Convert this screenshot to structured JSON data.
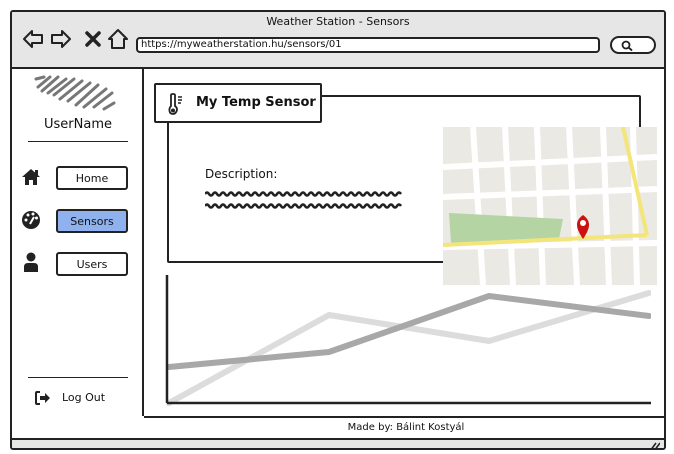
{
  "window": {
    "title": "Weather Station - Sensors"
  },
  "toolbar": {
    "back_icon": "left-arrow-outline-icon",
    "forward_icon": "right-arrow-outline-icon",
    "close_icon": "x-icon",
    "home_icon": "home-outline-icon",
    "url": "https://myweatherstation.hu/sensors/01",
    "search_icon": "search-icon"
  },
  "sidebar": {
    "username": "UserName",
    "items": [
      {
        "label": "Home",
        "icon": "home-icon",
        "active": false
      },
      {
        "label": "Sensors",
        "icon": "dashboard-icon",
        "active": true
      },
      {
        "label": "Users",
        "icon": "user-icon",
        "active": false
      }
    ],
    "logout_label": "Log Out",
    "active_color": "#8fb2ee"
  },
  "sensor": {
    "title": "My Temp Sensor",
    "icon": "thermometer-icon",
    "description_label": "Description:"
  },
  "map": {
    "marker_icon": "map-pin-icon",
    "marker_color": "#cc1111",
    "road_color": "#f3e57a",
    "park_color": "#b5d4a3"
  },
  "chart_data": {
    "type": "line",
    "title": "",
    "xlabel": "",
    "ylabel": "",
    "x": [
      0,
      1,
      2,
      3
    ],
    "series": [
      {
        "values": [
          3.6,
          5.1,
          10.7,
          8.7
        ],
        "color": "#a8a8a8"
      },
      {
        "values": [
          0.0,
          8.8,
          6.2,
          11.0
        ],
        "color": "#dcdcdc"
      }
    ],
    "ylim": [
      0,
      12
    ],
    "grid": false
  },
  "footer": {
    "text": "Made by: Bálint Kostyál"
  }
}
